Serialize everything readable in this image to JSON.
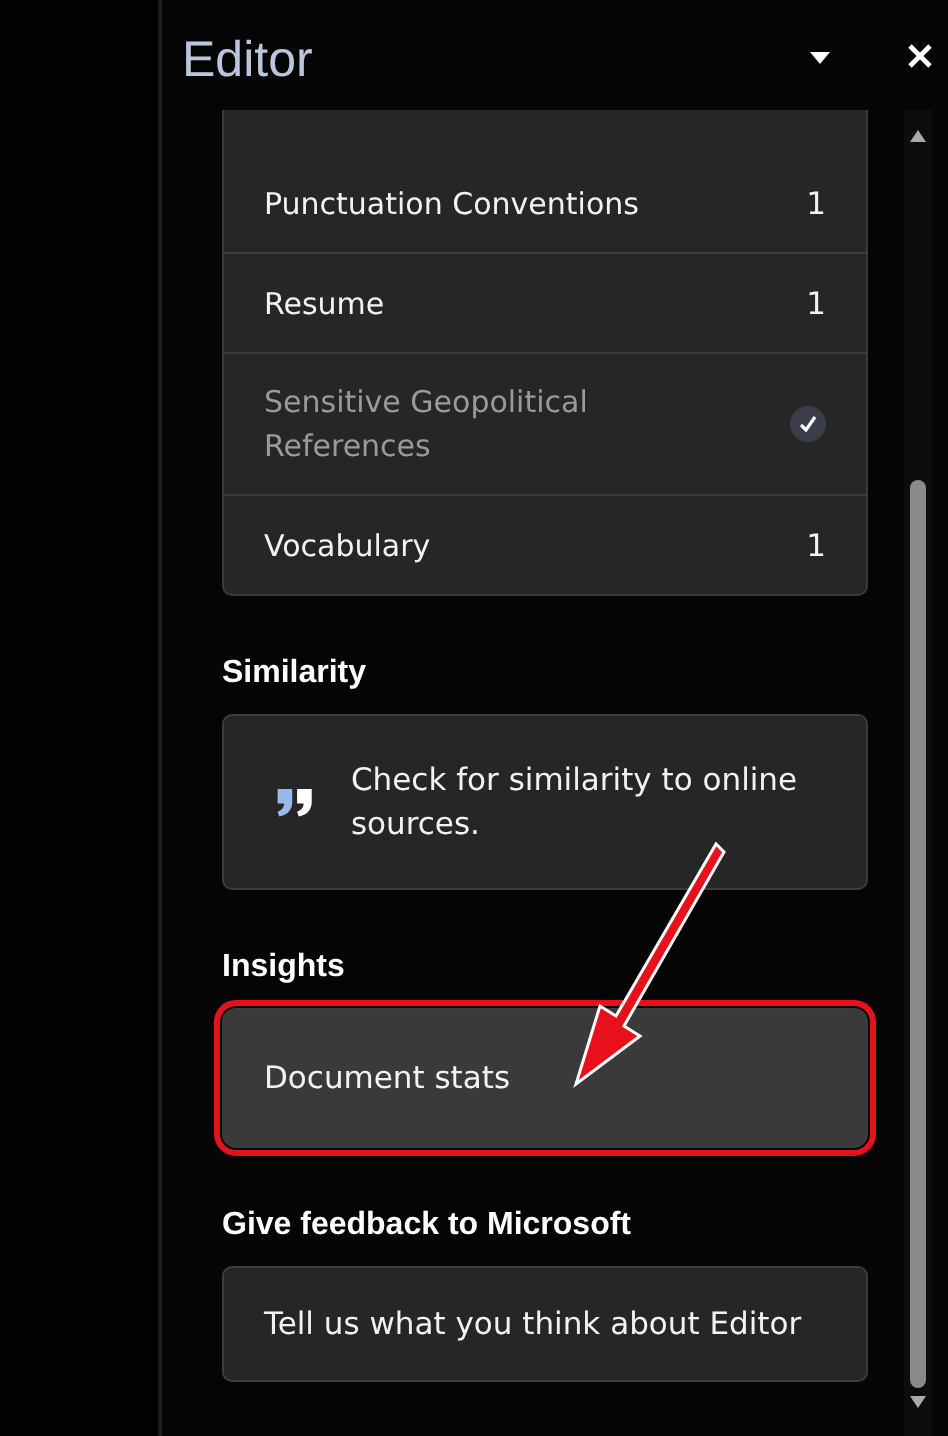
{
  "pane": {
    "title": "Editor"
  },
  "categories": [
    {
      "label": "Punctuation Conventions",
      "kind": "count",
      "count": "1",
      "resolved": false
    },
    {
      "label": "Resume",
      "kind": "count",
      "count": "1",
      "resolved": false
    },
    {
      "label": "Sensitive Geopolitical References",
      "kind": "check",
      "resolved": true
    },
    {
      "label": "Vocabulary",
      "kind": "count",
      "count": "1",
      "resolved": false
    }
  ],
  "similarity": {
    "heading": "Similarity",
    "text": "Check for similarity to online sources."
  },
  "insights": {
    "heading": "Insights",
    "button": "Document stats",
    "highlighted": true
  },
  "feedback": {
    "heading": "Give feedback to Microsoft",
    "button": "Tell us what you think about Editor"
  }
}
